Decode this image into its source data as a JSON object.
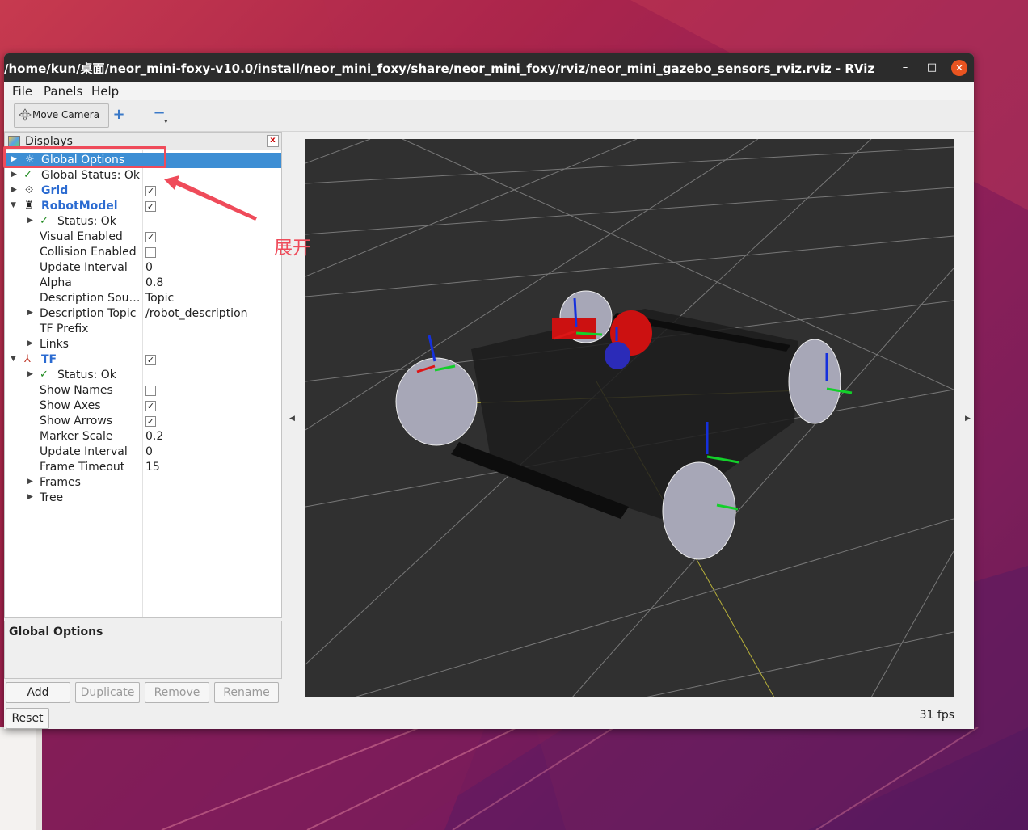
{
  "window": {
    "title": "/home/kun/桌面/neor_mini-foxy-v10.0/install/neor_mini_foxy/share/neor_mini_foxy/rviz/neor_mini_gazebo_sensors_rviz.rviz - RViz",
    "minimize_label": "–",
    "maximize_label": "□",
    "close_label": "✕"
  },
  "menu": {
    "file": "File",
    "panels": "Panels",
    "help": "Help"
  },
  "toolbar": {
    "move_camera": "Move Camera",
    "add_tool": "+",
    "remove_tool": "−"
  },
  "displays": {
    "title": "Displays",
    "close_label": "x",
    "rows": [
      {
        "name": "Global Options"
      },
      {
        "name": "Global Status: Ok"
      },
      {
        "name": "Grid"
      },
      {
        "name": "RobotModel"
      },
      {
        "name": "Status: Ok"
      },
      {
        "name": "Visual Enabled"
      },
      {
        "name": "Collision Enabled"
      },
      {
        "name": "Update Interval",
        "value": "0"
      },
      {
        "name": "Alpha",
        "value": "0.8"
      },
      {
        "name": "Description Sou…",
        "value": "Topic"
      },
      {
        "name": "Description Topic",
        "value": "/robot_description"
      },
      {
        "name": "TF Prefix"
      },
      {
        "name": "Links"
      },
      {
        "name": "TF"
      },
      {
        "name": "Status: Ok"
      },
      {
        "name": "Show Names"
      },
      {
        "name": "Show Axes"
      },
      {
        "name": "Show Arrows"
      },
      {
        "name": "Marker Scale",
        "value": "0.2"
      },
      {
        "name": "Update Interval",
        "value": "0"
      },
      {
        "name": "Frame Timeout",
        "value": "15"
      },
      {
        "name": "Frames"
      },
      {
        "name": "Tree"
      }
    ]
  },
  "annotation": {
    "label": "展开"
  },
  "description": {
    "title": "Global Options"
  },
  "buttons": {
    "add": "Add",
    "duplicate": "Duplicate",
    "remove": "Remove",
    "rename": "Rename",
    "reset": "Reset"
  },
  "status": {
    "fps": "31 fps"
  },
  "colors": {
    "selection": "#3d8ed4",
    "annotation": "#ef4b5a",
    "viewport_bg": "#303030",
    "titlebar": "#2c2c2c"
  }
}
